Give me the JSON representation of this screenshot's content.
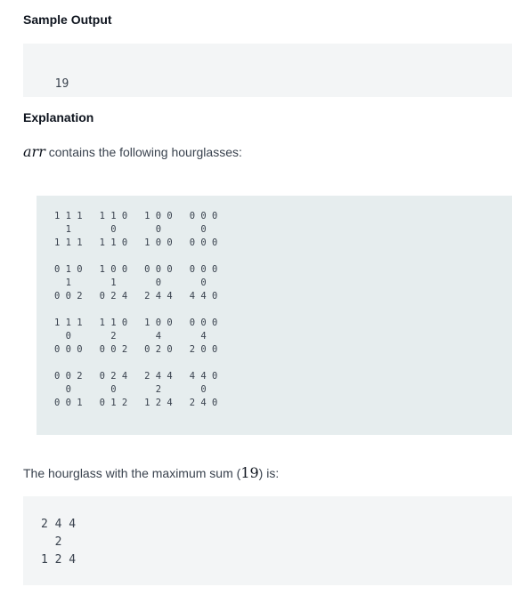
{
  "sample_output": {
    "heading": "Sample Output",
    "value": "19"
  },
  "explanation": {
    "heading": "Explanation",
    "intro_math": "arr",
    "intro_text": " contains the following hourglasses:",
    "hourglass_rows": [
      "1 1 1   1 1 0   1 0 0   0 0 0",
      "  1       0       0       0",
      "1 1 1   1 1 0   1 0 0   0 0 0",
      "",
      "0 1 0   1 0 0   0 0 0   0 0 0",
      "  1       1       0       0",
      "0 0 2   0 2 4   2 4 4   4 4 0",
      "",
      "1 1 1   1 1 0   1 0 0   0 0 0",
      "  0       2       4       4",
      "0 0 0   0 0 2   0 2 0   2 0 0",
      "",
      "0 0 2   0 2 4   2 4 4   4 4 0",
      "  0       0       2       0",
      "0 0 1   0 1 2   1 2 4   2 4 0"
    ],
    "max_text_before": "The hourglass with the maximum sum (",
    "max_value": "19",
    "max_text_after": ") is:",
    "max_hourglass": [
      "2 4 4",
      "  2",
      "1 2 4"
    ]
  }
}
